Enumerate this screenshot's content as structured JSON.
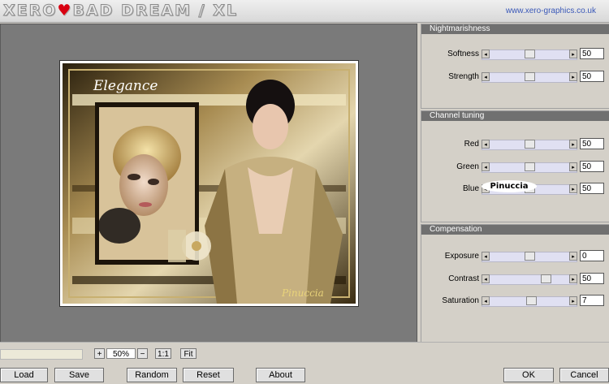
{
  "header": {
    "logo_left": "XERO",
    "logo_mid": "♥",
    "logo_right": "BAD DREAM / XL",
    "url": "www.xero-graphics.co.uk"
  },
  "preview": {
    "overlay_title": "Elegance",
    "signature": "Pinuccia"
  },
  "groups": {
    "nightmarishness": {
      "title": "Nightmarishness",
      "sliders": [
        {
          "label": "Softness",
          "value": "50",
          "level": 0.5
        },
        {
          "label": "Strength",
          "value": "50",
          "level": 0.5
        }
      ]
    },
    "channel": {
      "title": "Channel tuning",
      "sliders": [
        {
          "label": "Red",
          "value": "50",
          "level": 0.5
        },
        {
          "label": "Green",
          "value": "50",
          "level": 0.5
        },
        {
          "label": "Blue",
          "value": "50",
          "level": 0.5
        }
      ]
    },
    "compensation": {
      "title": "Compensation",
      "sliders": [
        {
          "label": "Exposure",
          "value": "0",
          "level": 0.5
        },
        {
          "label": "Contrast",
          "value": "50",
          "level": 0.75
        },
        {
          "label": "Saturation",
          "value": "7",
          "level": 0.53
        }
      ]
    }
  },
  "watermark": "Pinuccia",
  "zoom": {
    "plus": "+",
    "value": "50%",
    "minus": "−",
    "one_to_one": "1:1",
    "fit": "Fit"
  },
  "buttons": {
    "load": "Load",
    "save": "Save",
    "random": "Random",
    "reset": "Reset",
    "about": "About",
    "ok": "OK",
    "cancel": "Cancel"
  }
}
